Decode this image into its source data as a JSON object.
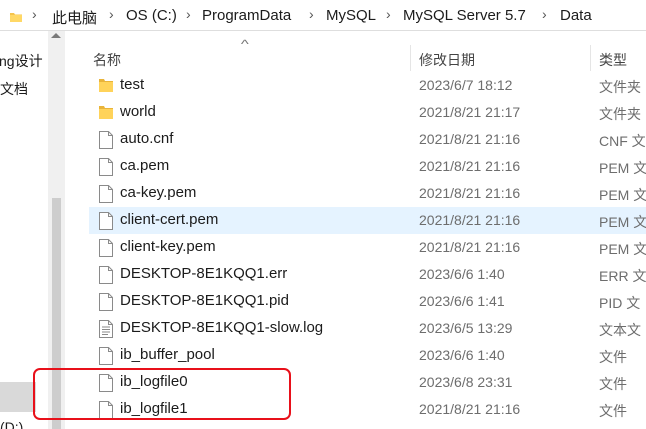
{
  "address_bar": {
    "segments": [
      "此电脑",
      "OS (C:)",
      "ProgramData",
      "MySQL",
      "MySQL Server 5.7",
      "Data"
    ]
  },
  "nav_pane": {
    "items": [
      "ng设计",
      "文档",
      "(D:)"
    ]
  },
  "columns": {
    "name": "名称",
    "date": "修改日期",
    "type": "类型"
  },
  "files": [
    {
      "name": "test",
      "date": "2023/6/7 18:12",
      "type": "文件夹",
      "icon": "folder-icon"
    },
    {
      "name": "world",
      "date": "2021/8/21 21:17",
      "type": "文件夹",
      "icon": "folder-icon"
    },
    {
      "name": "auto.cnf",
      "date": "2021/8/21 21:16",
      "type": "CNF 文",
      "icon": "file-icon"
    },
    {
      "name": "ca.pem",
      "date": "2021/8/21 21:16",
      "type": "PEM 文",
      "icon": "file-icon"
    },
    {
      "name": "ca-key.pem",
      "date": "2021/8/21 21:16",
      "type": "PEM 文",
      "icon": "file-icon"
    },
    {
      "name": "client-cert.pem",
      "date": "2021/8/21 21:16",
      "type": "PEM 文",
      "icon": "file-icon"
    },
    {
      "name": "client-key.pem",
      "date": "2021/8/21 21:16",
      "type": "PEM 文",
      "icon": "file-icon"
    },
    {
      "name": "DESKTOP-8E1KQQ1.err",
      "date": "2023/6/6 1:40",
      "type": "ERR 文",
      "icon": "file-icon"
    },
    {
      "name": "DESKTOP-8E1KQQ1.pid",
      "date": "2023/6/6 1:41",
      "type": "PID 文",
      "icon": "file-icon"
    },
    {
      "name": "DESKTOP-8E1KQQ1-slow.log",
      "date": "2023/6/5 13:29",
      "type": "文本文",
      "icon": "text-file-icon"
    },
    {
      "name": "ib_buffer_pool",
      "date": "2023/6/6 1:40",
      "type": "文件",
      "icon": "file-icon"
    },
    {
      "name": "ib_logfile0",
      "date": "2023/6/8 23:31",
      "type": "文件",
      "icon": "file-icon"
    },
    {
      "name": "ib_logfile1",
      "date": "2021/8/21 21:16",
      "type": "文件",
      "icon": "file-icon"
    }
  ],
  "highlighted_row": 5,
  "annotation_color": "#e8101a"
}
